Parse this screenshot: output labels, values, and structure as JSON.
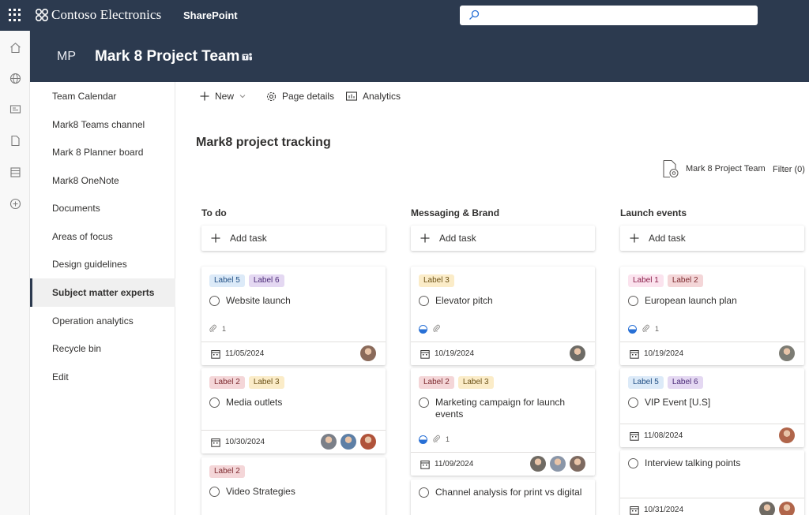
{
  "suite": {
    "brand": "Contoso Electronics",
    "app": "SharePoint"
  },
  "site": {
    "initials": "MP",
    "title": "Mark 8 Project Team"
  },
  "nav": {
    "items": [
      {
        "label": "Team Calendar"
      },
      {
        "label": "Mark8 Teams channel"
      },
      {
        "label": "Mark 8 Planner board"
      },
      {
        "label": "Mark8 OneNote"
      },
      {
        "label": "Documents"
      },
      {
        "label": "Areas of focus"
      },
      {
        "label": "Design guidelines"
      },
      {
        "label": "Subject matter experts",
        "active": true
      },
      {
        "label": "Operation analytics"
      },
      {
        "label": "Recycle bin"
      },
      {
        "label": "Edit"
      }
    ]
  },
  "commands": {
    "new": "New",
    "page_details": "Page details",
    "analytics": "Analytics"
  },
  "page": {
    "title": "Mark8 project tracking",
    "team_link": "Mark 8 Project Team",
    "filter": "Filter (0)"
  },
  "label_colors": {
    "Label 1": {
      "bg": "#fbe3ee",
      "fg": "#8b1d4a"
    },
    "Label 2": {
      "bg": "#f4d6d8",
      "fg": "#7d2a2f"
    },
    "Label 3": {
      "bg": "#fbecc8",
      "fg": "#6b5116"
    },
    "Label 5": {
      "bg": "#dceaf8",
      "fg": "#1f4e84"
    },
    "Label 6": {
      "bg": "#e4d8f2",
      "fg": "#4b2a78"
    }
  },
  "buckets": [
    {
      "title": "To do",
      "add_task": "Add task",
      "tasks": [
        {
          "labels": [
            "Label 5",
            "Label 6"
          ],
          "name": "Website launch",
          "attachments": "1",
          "due": "11/05/2024",
          "avatars": [
            "#8a6a5a"
          ]
        },
        {
          "labels": [
            "Label 2",
            "Label 3"
          ],
          "name": "Media outlets",
          "due": "10/30/2024",
          "avatars": [
            "#7a7f88",
            "#5d7fa6",
            "#b0533a"
          ]
        },
        {
          "labels": [
            "Label 2"
          ],
          "name": "Video Strategies"
        }
      ]
    },
    {
      "title": "Messaging & Brand",
      "add_task": "Add task",
      "tasks": [
        {
          "labels": [
            "Label 3"
          ],
          "name": "Elevator pitch",
          "attachments": "",
          "progress": true,
          "due": "10/19/2024",
          "avatars": [
            "#6d6b66"
          ]
        },
        {
          "labels": [
            "Label 2",
            "Label 3"
          ],
          "name": "Marketing campaign for launch events",
          "attachments": "1",
          "progress": true,
          "due": "11/09/2024",
          "avatars": [
            "#6f6a63",
            "#8a96a8",
            "#7d6a60"
          ]
        },
        {
          "labels": [],
          "name": "Channel analysis for print vs digital"
        }
      ]
    },
    {
      "title": "Launch events",
      "add_task": "Add task",
      "tasks": [
        {
          "labels": [
            "Label 1",
            "Label 2"
          ],
          "name": "European launch plan",
          "attachments": "1",
          "progress": true,
          "due": "10/19/2024",
          "avatars": [
            "#7c7c74"
          ]
        },
        {
          "labels": [
            "Label 5",
            "Label 6"
          ],
          "name": "VIP Event [U.S]",
          "due": "11/08/2024",
          "avatars": [
            "#b0654a"
          ]
        },
        {
          "labels": [],
          "name": "Interview talking points",
          "due": "10/31/2024",
          "avatars": [
            "#6f6a63",
            "#b0654a"
          ]
        }
      ]
    }
  ]
}
